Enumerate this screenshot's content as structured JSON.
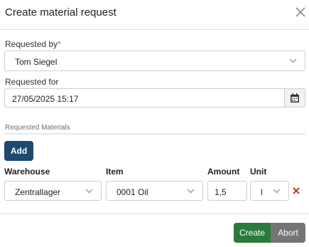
{
  "dialog": {
    "title": "Create material request",
    "close_icon": "close-icon"
  },
  "form": {
    "requested_by_label": "Requested by",
    "required_marker": "*",
    "requested_by_value": "Tom Siegel",
    "requested_for_label": "Requested for",
    "requested_for_value": "27/05/2025 15:17",
    "calendar_icon": "calendar-icon"
  },
  "materials": {
    "section_label": "Requested Materials",
    "add_label": "Add",
    "columns": {
      "warehouse": "Warehouse",
      "item": "Item",
      "amount": "Amount",
      "unit": "Unit"
    },
    "rows": [
      {
        "warehouse": "Zentrallager",
        "item": "0001 Oil",
        "amount": "1,5",
        "unit": "l"
      }
    ],
    "remove_icon": "remove-icon"
  },
  "footer": {
    "create_label": "Create",
    "abort_label": "Abort"
  },
  "colors": {
    "primary": "#1d4a6e",
    "create": "#2b7a3d",
    "abort": "#757575",
    "required": "#d9534f",
    "remove": "#c0392b"
  }
}
